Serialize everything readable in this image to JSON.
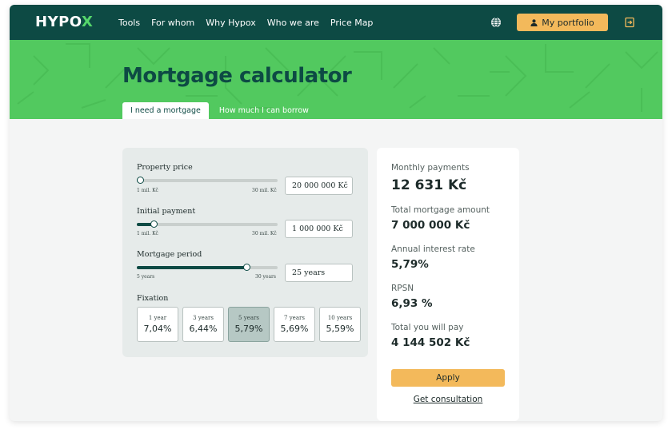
{
  "nav": {
    "logo_main": "HYPO",
    "logo_accent": "X",
    "menu": [
      "Tools",
      "For whom",
      "Why Hypox",
      "Who we are",
      "Price Map"
    ],
    "language_icon": "globe-icon",
    "portfolio_label": "My portfolio",
    "portfolio_icon": "user-icon",
    "logout_icon": "logout-icon"
  },
  "hero": {
    "title": "Mortgage calculator",
    "tabs": [
      {
        "label": "I need a mortgage",
        "active": true
      },
      {
        "label": "How much I can borrow",
        "active": false
      }
    ]
  },
  "calculator": {
    "property_price": {
      "label": "Property price",
      "min": "1 mil. Kč",
      "max": "30 mil. Kč",
      "value": "20 000 000 Kč",
      "slider_fraction": 0.02
    },
    "initial_payment": {
      "label": "Initial payment",
      "min": "1 mil. Kč",
      "max": "30 mil. Kč",
      "value": "1 000 000 Kč",
      "slider_fraction": 0.12
    },
    "mortgage_period": {
      "label": "Mortgage period",
      "min": "5 years",
      "max": "30 years",
      "value": "25 years",
      "slider_fraction": 0.78
    },
    "fixation": {
      "label": "Fixation",
      "options": [
        {
          "years": "1 year",
          "rate": "7,04%",
          "selected": false
        },
        {
          "years": "3 years",
          "rate": "6,44%",
          "selected": false
        },
        {
          "years": "5 years",
          "rate": "5,79%",
          "selected": true
        },
        {
          "years": "7 years",
          "rate": "5,69%",
          "selected": false
        },
        {
          "years": "10 years",
          "rate": "5,59%",
          "selected": false
        }
      ]
    }
  },
  "summary": {
    "monthly_label": "Monthly payments",
    "monthly_value": "12 631 Kč",
    "total_mortgage_label": "Total mortgage amount",
    "total_mortgage_value": "7 000 000 Kč",
    "interest_label": "Annual interest rate",
    "interest_value": "5,79%",
    "rpsn_label": "RPSN",
    "rpsn_value": "6,93 %",
    "total_pay_label": "Total you will pay",
    "total_pay_value": "4 144 502 Kč",
    "apply_label": "Apply",
    "consult_label": "Get consultation"
  },
  "colors": {
    "nav_bg": "#0d4a44",
    "hero_bg": "#52c95f",
    "accent_button": "#f3b95b",
    "selected_fixation": "#b6c8c4"
  }
}
